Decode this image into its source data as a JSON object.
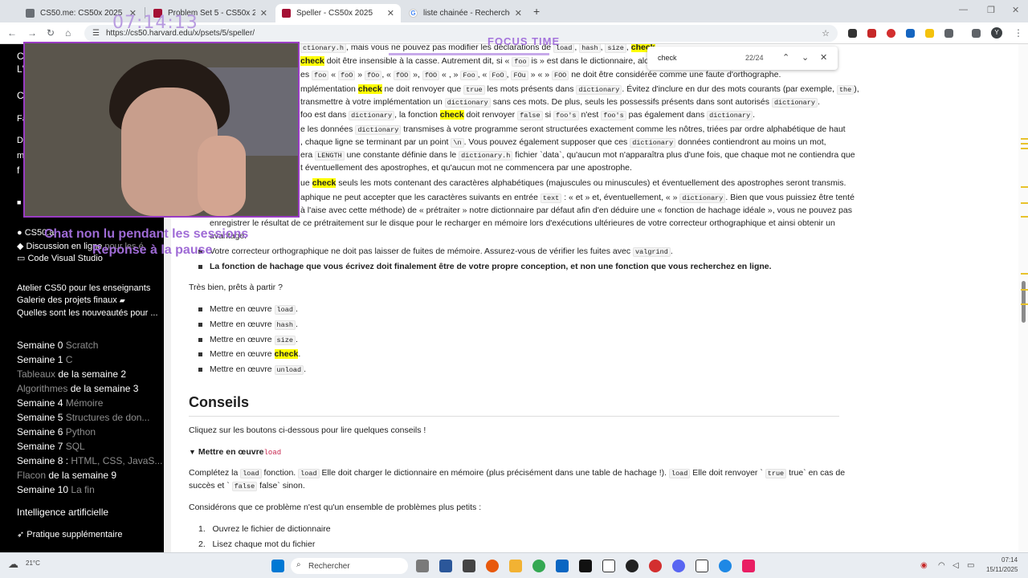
{
  "tabs": [
    {
      "title": "CS50.me: CS50x 2025",
      "icon_color": "#6a6f75"
    },
    {
      "title": "Problem Set 5 - CS50x 2025",
      "icon_color": "#a41034"
    },
    {
      "title": "Speller - CS50x 2025",
      "icon_color": "#a41034"
    },
    {
      "title": "liste chainée - Recherche Goog",
      "icon_color": "#4285f4"
    }
  ],
  "address": {
    "url": "https://cs50.harvard.edu/x/psets/5/speller/"
  },
  "find": {
    "query": "check",
    "count": "22/24"
  },
  "overlay": {
    "timer": "07:14:13",
    "focus": "FOCUS TIME",
    "msg1": "Chat non lu pendant les sessions",
    "msg2": "Reponse à la pause"
  },
  "sidebar": {
    "top_letters": [
      "C",
      "L'",
      "C",
      "Fa",
      "D",
      "m"
    ],
    "cs50ai": "CS50.ai",
    "discussion": "Discussion en ligne",
    "discussion_tail": "pour les é",
    "vscode": "Code Visual Studio",
    "atelier": "Atelier CS50 pour les enseignants",
    "galerie": "Galerie des projets finaux",
    "nouveautes": "Quelles sont les nouveautés pour ...",
    "weeks": [
      {
        "a": "Semaine 0 ",
        "b": "Scratch"
      },
      {
        "a": "Semaine 1 ",
        "b": "C"
      },
      {
        "b": "Tableaux ",
        "a": "de la semaine 2",
        "rev": true
      },
      {
        "b": "Algorithmes ",
        "a": "de la semaine 3",
        "rev": true
      },
      {
        "a": "Semaine 4 ",
        "b": "Mémoire"
      },
      {
        "a": "Semaine 5 ",
        "b": "Structures de don..."
      },
      {
        "a": "Semaine 6 ",
        "b": "Python"
      },
      {
        "a": "Semaine 7 ",
        "b": "SQL"
      },
      {
        "a": "Semaine 8 : ",
        "b": "HTML, CSS, JavaS..."
      },
      {
        "b": "Flacon ",
        "a": "de la semaine 9",
        "rev": true
      },
      {
        "a": "Semaine 10 ",
        "b": "La fin"
      }
    ],
    "ia": "Intelligence artificielle",
    "pratique": "Pratique supplémentaire"
  },
  "content": {
    "l1": [
      {
        "c": "ctionary.h"
      },
      {
        "t": ", mais vous ne pouvez pas modifier les déclarations de "
      },
      {
        "c": "load"
      },
      {
        "t": ", "
      },
      {
        "c": "hash"
      },
      {
        "t": ", "
      },
      {
        "c": "size"
      },
      {
        "t": ", "
      },
      {
        "h": "check"
      },
      {
        "t": ", "
      }
    ],
    "l2": [
      {
        "h": "check"
      },
      {
        "t": " doit être insensible à la casse. Autrement dit, si « "
      },
      {
        "c": "foo"
      },
      {
        "t": " is » est dans le dictionnaire, alors "
      },
      {
        "h": "ch"
      }
    ],
    "l3": [
      {
        "t": "es "
      },
      {
        "c": "foo"
      },
      {
        "t": " « "
      },
      {
        "c": "foO"
      },
      {
        "t": " » "
      },
      {
        "c": "fOo"
      },
      {
        "t": ", « "
      },
      {
        "c": "fOO"
      },
      {
        "t": " », "
      },
      {
        "c": "fOO"
      },
      {
        "t": " « , » "
      },
      {
        "c": "Foo"
      },
      {
        "t": ", « "
      },
      {
        "c": "FoO"
      },
      {
        "t": ", "
      },
      {
        "c": "FOu"
      },
      {
        "t": " » « » "
      },
      {
        "c": "FOO"
      },
      {
        "t": " ne doit être considérée comme une faute d'orthographe."
      }
    ],
    "l4": [
      {
        "t": "mplémentation "
      },
      {
        "h": "check"
      },
      {
        "t": " ne doit renvoyer que "
      },
      {
        "c": "true"
      },
      {
        "t": " les mots présents dans "
      },
      {
        "c": "dictionary"
      },
      {
        "t": ". Évitez d'inclure en dur des mots courants (par exemple, "
      },
      {
        "c": "the"
      },
      {
        "t": "),"
      }
    ],
    "l5": [
      {
        "t": " transmettre à votre implémentation un "
      },
      {
        "c": "dictionary"
      },
      {
        "t": " sans ces mots. De plus, seuls les possessifs présents dans sont autorisés "
      },
      {
        "c": "dictionary"
      },
      {
        "t": "."
      }
    ],
    "l6": [
      {
        "t": "foo est dans "
      },
      {
        "c": "dictionary"
      },
      {
        "t": ", la fonction "
      },
      {
        "h": "check"
      },
      {
        "t": " doit renvoyer "
      },
      {
        "c": "false"
      },
      {
        "t": " si "
      },
      {
        "c": "foo's"
      },
      {
        "t": " n'est "
      },
      {
        "c": "foo's"
      },
      {
        "t": " pas également dans "
      },
      {
        "c": "dictionary"
      },
      {
        "t": "."
      }
    ],
    "l7": [
      {
        "t": "e les données "
      },
      {
        "c": "dictionary"
      },
      {
        "t": " transmises à votre programme seront structurées exactement comme les nôtres, triées par ordre alphabétique de haut"
      }
    ],
    "l8": [
      {
        "t": ", chaque ligne se terminant par un point "
      },
      {
        "c": "\\n"
      },
      {
        "t": ". Vous pouvez également supposer que ces "
      },
      {
        "c": "dictionary"
      },
      {
        "t": " données contiendront au moins un mot,"
      }
    ],
    "l9": [
      {
        "t": "era "
      },
      {
        "c": "LENGTH"
      },
      {
        "t": " une constante définie dans le "
      },
      {
        "c": "dictionary.h"
      },
      {
        "t": " fichier `data`, qu'aucun mot n'apparaîtra plus d'une fois, que chaque mot ne contiendra que"
      }
    ],
    "l10": [
      {
        "t": "t éventuellement des apostrophes, et qu'aucun mot ne commencera par une apostrophe."
      }
    ],
    "l11": [
      {
        "t": "ue "
      },
      {
        "h": "check"
      },
      {
        "t": " seuls les mots contenant des caractères alphabétiques (majuscules ou minuscules) et éventuellement des apostrophes seront transmis."
      }
    ],
    "l12": [
      {
        "t": "aphique ne peut accepter que les caractères suivants en entrée "
      },
      {
        "c": "text"
      },
      {
        "t": " : « et » et, éventuellement, « » "
      },
      {
        "c": "dictionary"
      },
      {
        "t": ". Bien que vous puissiez être tenté"
      }
    ],
    "l13": [
      {
        "t": " à l'aise avec cette méthode) de « prétraiter » notre dictionnaire par défaut afin d'en déduire une « fonction de hachage idéale », vous ne pouvez pas"
      }
    ],
    "l14": [
      {
        "t": "enregistrer le résultat de ce prétraitement sur le disque pour le recharger en mémoire lors d'exécutions ultérieures de votre correcteur orthographique et ainsi obtenir un"
      }
    ],
    "l15": [
      {
        "t": "avantage."
      }
    ],
    "b1": [
      {
        "t": "Votre correcteur orthographique ne doit pas laisser de fuites de mémoire. Assurez-vous de vérifier les fuites avec "
      },
      {
        "c": "valgrind"
      },
      {
        "t": "."
      }
    ],
    "b2": [
      {
        "t": "La fonction de hachage que vous écrivez doit finalement être de votre propre conception, et non une fonction que vous recherchez en ligne."
      }
    ],
    "ready": [
      {
        "t": "Très bien, prêts à partir ?"
      }
    ],
    "impl": [
      [
        {
          "t": "Mettre en œuvre "
        },
        {
          "c": "load"
        },
        {
          "t": "."
        }
      ],
      [
        {
          "t": "Mettre en œuvre "
        },
        {
          "c": "hash"
        },
        {
          "t": "."
        }
      ],
      [
        {
          "t": "Mettre en œuvre "
        },
        {
          "c": "size"
        },
        {
          "t": "."
        }
      ],
      [
        {
          "t": "Mettre en œuvre "
        },
        {
          "h": "check"
        },
        {
          "t": "."
        }
      ],
      [
        {
          "t": "Mettre en œuvre "
        },
        {
          "c": "unload"
        },
        {
          "t": "."
        }
      ]
    ],
    "heading": "Conseils",
    "click": [
      {
        "t": "Cliquez sur les boutons ci-dessous pour lire quelques conseils !"
      }
    ],
    "summary_text": "Mettre en œuvre",
    "summary_code": "load",
    "p1a": [
      {
        "t": "Complétez la "
      },
      {
        "c": "load"
      },
      {
        "t": " fonction. "
      },
      {
        "c": "load"
      },
      {
        "t": " Elle doit charger le dictionnaire en mémoire (plus précisément dans une table de hachage !). "
      },
      {
        "c": "load"
      },
      {
        "t": " Elle doit renvoyer ` "
      },
      {
        "c": "true"
      },
      {
        "t": " true` en cas de"
      }
    ],
    "p1b": [
      {
        "t": "succès et ` "
      },
      {
        "c": "false"
      },
      {
        "t": " false` sinon."
      }
    ],
    "p2": [
      {
        "t": "Considérons que ce problème n'est qu'un ensemble de problèmes plus petits :"
      }
    ],
    "steps": [
      "Ouvrez le fichier de dictionnaire",
      "Lisez chaque mot du fichier"
    ]
  },
  "taskbar": {
    "search": "Rechercher",
    "weather": "21°C",
    "time": "07:14",
    "date": "15/11/2025"
  },
  "colors": {
    "accent_purple": "#9f6bd6",
    "highlight": "#ffff00",
    "sidebar_bg": "#000000"
  }
}
